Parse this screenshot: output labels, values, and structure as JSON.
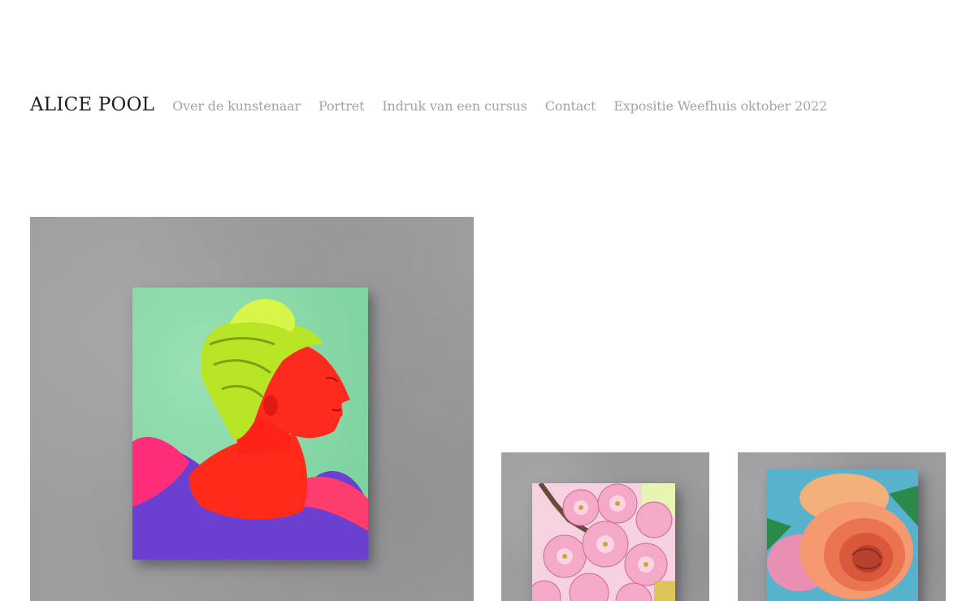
{
  "site": {
    "title": "ALICE POOL"
  },
  "nav": {
    "items": [
      {
        "label": "Over de kunstenaar"
      },
      {
        "label": "Portret"
      },
      {
        "label": "Indruk van een cursus"
      },
      {
        "label": "Contact"
      },
      {
        "label": "Expositie Weefhuis oktober 2022"
      }
    ]
  },
  "colors": {
    "title": "#1e1e1e",
    "nav_link": "#a3a3a8",
    "wall": "#9d9c9f",
    "portrait_background": "#7fd6a0",
    "portrait_figure": "#ff2a2a",
    "portrait_hair": "#c6f02a"
  },
  "gallery": {
    "items": [
      {
        "name": "portrait-red-woman-green-hair"
      },
      {
        "name": "pink-blossom-painting"
      },
      {
        "name": "peach-rose-painting"
      }
    ]
  }
}
